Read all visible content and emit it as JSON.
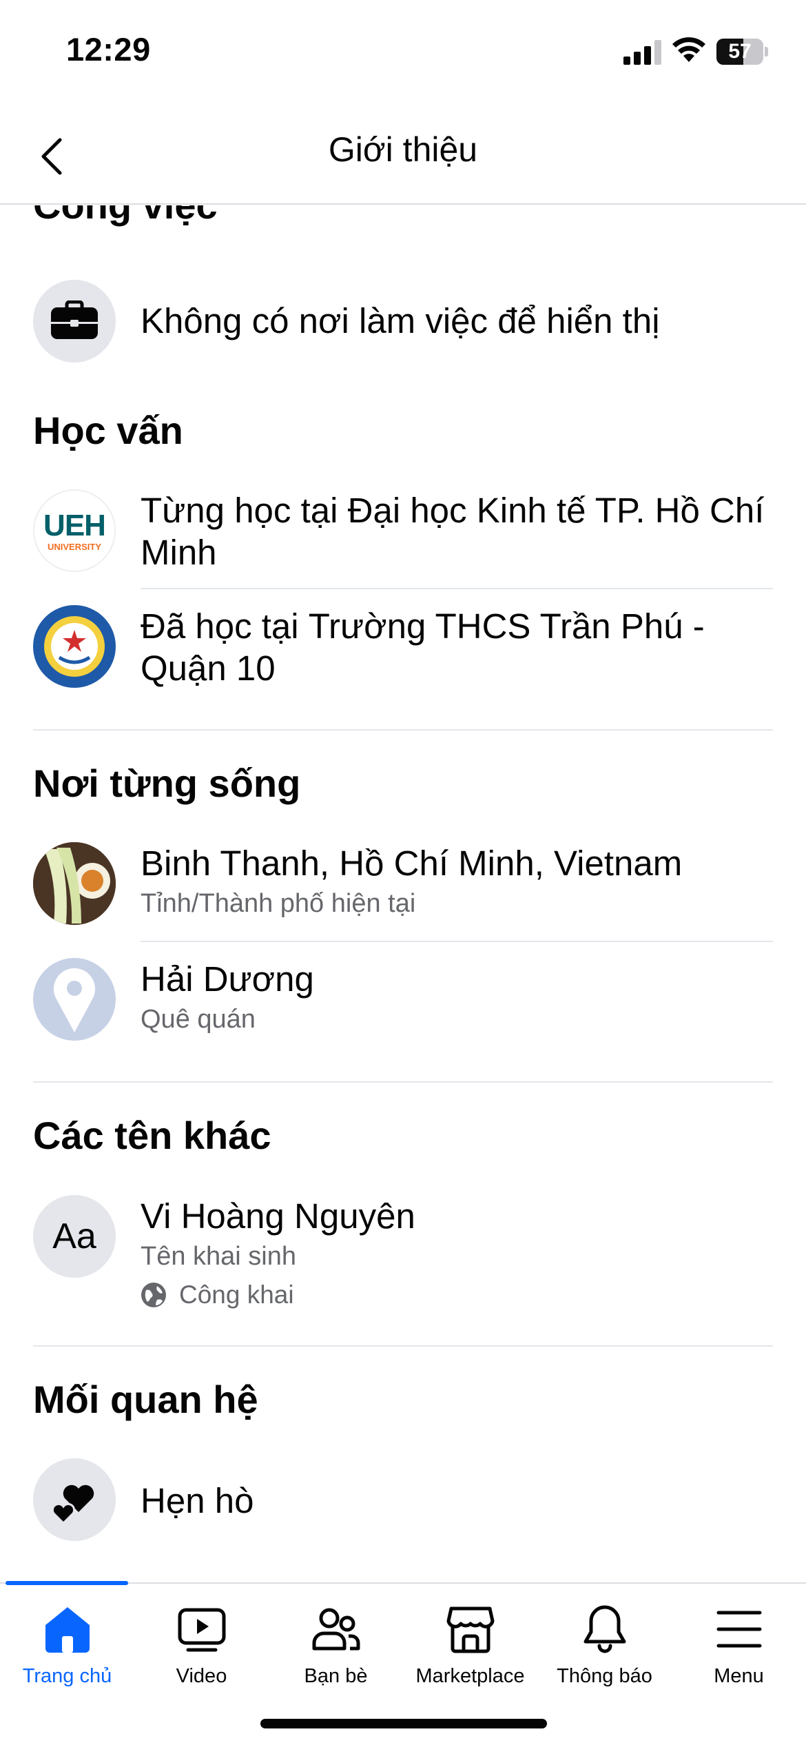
{
  "status_bar": {
    "time": "12:29",
    "battery": "57",
    "battery_level": 0.57
  },
  "header": {
    "title": "Giới thiệu"
  },
  "work": {
    "title": "Công việc",
    "item": "Không có nơi làm việc để hiển thị"
  },
  "education": {
    "title": "Học vấn",
    "items": [
      {
        "prefix": "Từng học tại ",
        "school": "Đại học Kinh tế TP. Hồ Chí Minh",
        "logo_text": "UEH",
        "logo_sub": "UNIVERSITY"
      },
      {
        "prefix": "Đã học tại ",
        "school": "Trường THCS Trần Phú - Quận 10"
      }
    ]
  },
  "places": {
    "title": "Nơi từng sống",
    "items": [
      {
        "name": "Binh Thanh, Hồ Chí Minh, Vietnam",
        "sub": "Tỉnh/Thành phố hiện tại"
      },
      {
        "name": "Hải Dương",
        "sub": "Quê quán"
      }
    ]
  },
  "other_names": {
    "title": "Các tên khác",
    "icon_text": "Aa",
    "name": "Vi Hoàng Nguyên",
    "sub": "Tên khai sinh",
    "privacy": "Công khai"
  },
  "relationship": {
    "title": "Mối quan hệ",
    "item": "Hẹn hò"
  },
  "tabbar": {
    "tabs": [
      {
        "label": "Trang chủ",
        "icon": "home-icon",
        "active": true
      },
      {
        "label": "Video",
        "icon": "video-icon"
      },
      {
        "label": "Bạn bè",
        "icon": "friends-icon"
      },
      {
        "label": "Marketplace",
        "icon": "marketplace-icon"
      },
      {
        "label": "Thông báo",
        "icon": "bell-icon"
      },
      {
        "label": "Menu",
        "icon": "menu-icon"
      }
    ]
  },
  "colors": {
    "accent": "#0866ff",
    "secondary_text": "#65676b",
    "icon_bg": "#e4e6eb",
    "divider": "#e4e6eb"
  }
}
